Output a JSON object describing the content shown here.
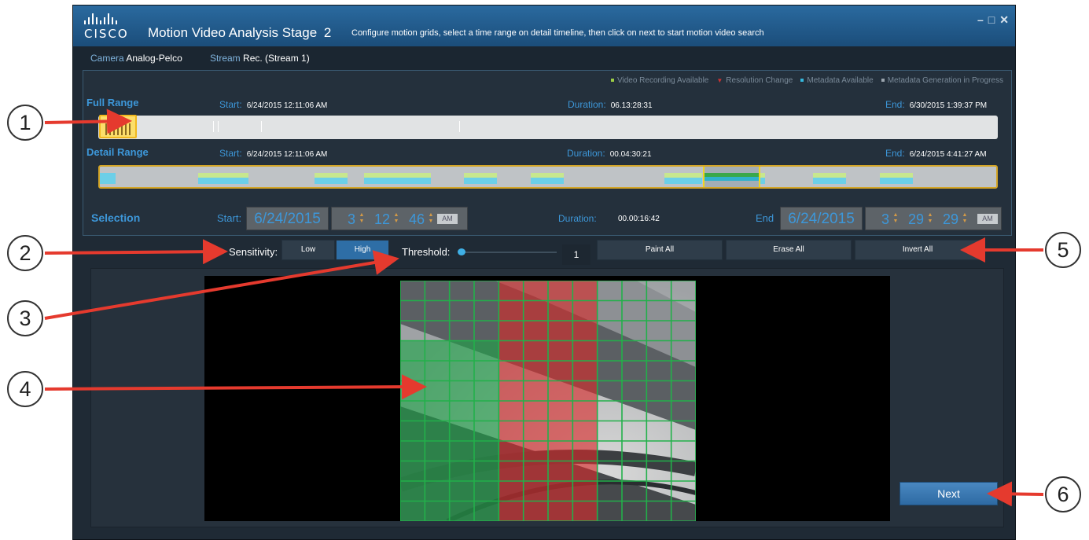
{
  "brand": {
    "name": "CISCO"
  },
  "window": {
    "title": "Motion Video Analysis Stage",
    "stage_number": "2",
    "subtitle": "Configure motion grids, select a time range on detail timeline, then click on next to start motion video search",
    "controls": {
      "minimize": "–",
      "maximize": "□",
      "close": "✕"
    }
  },
  "camera": {
    "label": "Camera",
    "value": "Analog-Pelco",
    "stream_label": "Stream",
    "stream_value": "Rec. (Stream 1)"
  },
  "legend": [
    {
      "label": "Video Recording Available",
      "color": "#9ccd45",
      "shape": "square"
    },
    {
      "label": "Resolution Change",
      "color": "#cc3333",
      "shape": "triangle"
    },
    {
      "label": "Metadata Available",
      "color": "#35b8de",
      "shape": "square"
    },
    {
      "label": "Metadata Generation in Progress",
      "color": "#9aa4ad",
      "shape": "square"
    }
  ],
  "full_range": {
    "title": "Full Range",
    "start_label": "Start:",
    "start": "6/24/2015 12:11:06 AM",
    "duration_label": "Duration:",
    "duration": "06.13:28:31",
    "end_label": "End:",
    "end": "6/30/2015 1:39:37 PM"
  },
  "detail_range": {
    "title": "Detail Range",
    "start_label": "Start:",
    "start": "6/24/2015 12:11:06 AM",
    "duration_label": "Duration:",
    "duration": "00.04:30:21",
    "end_label": "End:",
    "end": "6/24/2015 4:41:27 AM"
  },
  "selection": {
    "title": "Selection",
    "start_label": "Start:",
    "start_date": "6/24/2015",
    "start_hour": "3",
    "start_min": "12",
    "start_sec": "46",
    "start_ampm": "AM",
    "duration_label": "Duration:",
    "duration": "00.00:16:42",
    "end_label": "End",
    "end_date": "6/24/2015",
    "end_hour": "3",
    "end_min": "29",
    "end_sec": "29",
    "end_ampm": "AM"
  },
  "controls": {
    "sensitivity_label": "Sensitivity:",
    "sensitivity_low": "Low",
    "sensitivity_high": "High",
    "sensitivity_selected": "High",
    "threshold_label": "Threshold:",
    "threshold_value": "1",
    "paint_all": "Paint All",
    "erase_all": "Erase All",
    "invert_all": "Invert All"
  },
  "grid": {
    "columns": 12,
    "rows": 12,
    "green_columns": "0-3",
    "red_columns": "4-7",
    "colors": {
      "green": "#1fa448",
      "red": "#d92a2a",
      "lines": "#22b04a"
    }
  },
  "next_button": "Next",
  "callouts": [
    "1",
    "2",
    "3",
    "4",
    "5",
    "6"
  ]
}
